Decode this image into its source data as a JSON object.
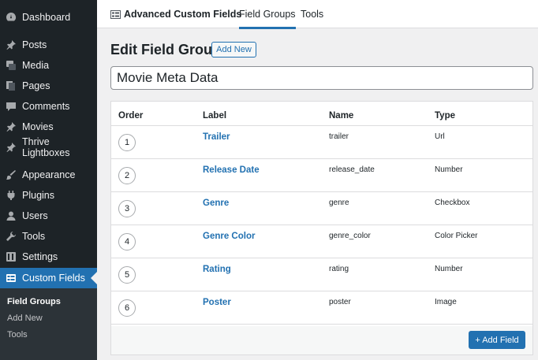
{
  "sidebar": {
    "items": [
      {
        "label": "Dashboard",
        "icon": "dashboard-icon"
      },
      {
        "label": "Posts",
        "icon": "pin-icon"
      },
      {
        "label": "Media",
        "icon": "media-icon"
      },
      {
        "label": "Pages",
        "icon": "pages-icon"
      },
      {
        "label": "Comments",
        "icon": "comment-icon"
      },
      {
        "label": "Movies",
        "icon": "pin-icon"
      },
      {
        "label": "Thrive Lightboxes",
        "icon": "pin-icon"
      },
      {
        "label": "Appearance",
        "icon": "brush-icon"
      },
      {
        "label": "Plugins",
        "icon": "plug-icon"
      },
      {
        "label": "Users",
        "icon": "user-icon"
      },
      {
        "label": "Tools",
        "icon": "wrench-icon"
      },
      {
        "label": "Settings",
        "icon": "settings-icon"
      },
      {
        "label": "Custom Fields",
        "icon": "grid-icon"
      }
    ],
    "submenu": [
      "Field Groups",
      "Add New",
      "Tools"
    ]
  },
  "topnav": {
    "brand": "Advanced Custom Fields",
    "tabs": [
      "Field Groups",
      "Tools"
    ]
  },
  "page": {
    "title": "Edit Field Group",
    "add_new": "Add New",
    "group_title": "Movie Meta Data"
  },
  "table": {
    "headers": [
      "Order",
      "Label",
      "Name",
      "Type"
    ],
    "rows": [
      {
        "order": "1",
        "label": "Trailer",
        "name": "trailer",
        "type": "Url"
      },
      {
        "order": "2",
        "label": "Release Date",
        "name": "release_date",
        "type": "Number"
      },
      {
        "order": "3",
        "label": "Genre",
        "name": "genre",
        "type": "Checkbox"
      },
      {
        "order": "4",
        "label": "Genre Color",
        "name": "genre_color",
        "type": "Color Picker"
      },
      {
        "order": "5",
        "label": "Rating",
        "name": "rating",
        "type": "Number"
      },
      {
        "order": "6",
        "label": "Poster",
        "name": "poster",
        "type": "Image"
      }
    ],
    "add_field": "+ Add Field"
  },
  "colors": {
    "accent": "#2271b1",
    "sidebar_bg": "#1d2327",
    "submenu_bg": "#2c3338"
  }
}
